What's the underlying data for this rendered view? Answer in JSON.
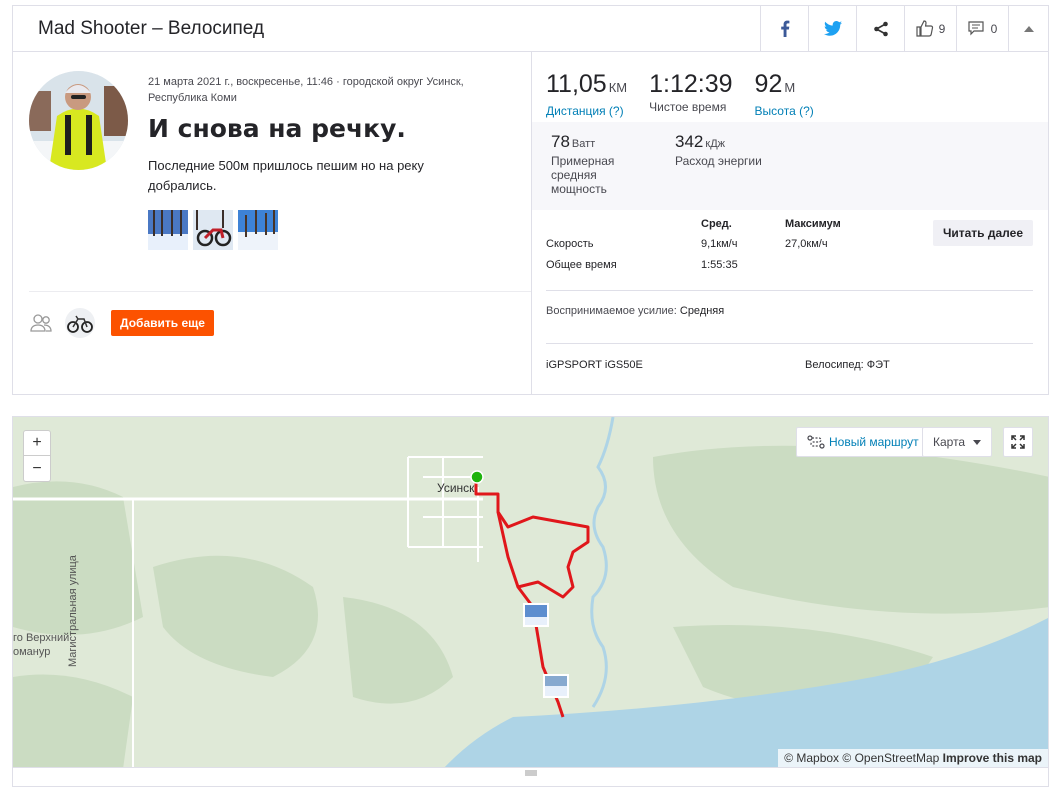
{
  "header": {
    "title": "Mad Shooter – Велосипед",
    "kudos_count": "9",
    "comments_count": "0"
  },
  "activity": {
    "meta": "21 марта 2021 г., воскресенье, 11:46 · городской округ Усинск, Республика Коми",
    "title": "И снова на речку.",
    "description": "Последние 500м пришлось пешим но на реку добрались.",
    "add_button": "Добавить еще"
  },
  "stats": {
    "distance": {
      "value": "11,05",
      "unit": "КМ",
      "label": "Дистанция (?)"
    },
    "moving_time": {
      "value": "1:12:39",
      "label": "Чистое время"
    },
    "elevation": {
      "value": "92",
      "unit": "М",
      "label": "Высота (?)"
    },
    "power": {
      "value": "78",
      "unit": "Ватт",
      "label": "Примерная средняя мощность"
    },
    "energy": {
      "value": "342",
      "unit": "кДж",
      "label": "Расход энергии"
    }
  },
  "table": {
    "col_avg": "Сред.",
    "col_max": "Максимум",
    "rows": [
      {
        "label": "Скорость",
        "avg": "9,1км/ч",
        "max": "27,0км/ч"
      },
      {
        "label": "Общее время",
        "avg": "1:55:35",
        "max": ""
      }
    ],
    "read_more": "Читать далее"
  },
  "effort": {
    "label": "Воспринимаемое усилие:",
    "value": "Средняя"
  },
  "device": "iGPSPORT iGS50E",
  "bike": "Велосипед: ФЭТ",
  "map": {
    "zoom_in": "+",
    "zoom_out": "−",
    "new_route": "Новый маршрут",
    "map_type": "Карта",
    "label_town": "Усинск",
    "label_street": "Магистральная улица",
    "label_left1": "го Верхний",
    "label_left2": "оманур",
    "attribution_mapbox": "© Mapbox",
    "attribution_osm": "© OpenStreetMap",
    "attribution_improve": "Improve this map"
  },
  "colors": {
    "accent": "#fc5200",
    "link": "#007fb6",
    "route": "#e0171b",
    "water": "#aed4e6",
    "land": "#dfe9d7"
  }
}
